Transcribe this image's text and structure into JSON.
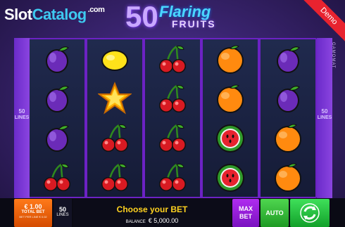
{
  "watermark": {
    "slot": "Slot",
    "catalog": "Catalog",
    "dotcom": ".com"
  },
  "logo": {
    "number": "50",
    "flaring": "Flaring",
    "fruits": "FRUITS"
  },
  "demo_label": "Demo",
  "provider": "GAMOMAT",
  "side_lines": {
    "count": "50",
    "label": "LINES"
  },
  "reels": [
    [
      "plum",
      "plum",
      "plum",
      "cherry"
    ],
    [
      "lemon",
      "star",
      "cherry",
      "cherry"
    ],
    [
      "cherry",
      "cherry",
      "cherry",
      "cherry"
    ],
    [
      "orange",
      "orange",
      "watermelon",
      "watermelon"
    ],
    [
      "plum",
      "plum",
      "orange",
      "orange"
    ]
  ],
  "bottom": {
    "bet_value": "€ 1.00",
    "bet_label": "TOTAL BET",
    "bet_sub": "BET PER LINE € 0.02",
    "lines_count": "50",
    "lines_label": "LINES",
    "message": "Choose your BET",
    "balance_label": "BALANCE",
    "balance_value": "€ 5,000.00",
    "maxbet_label": "MAX BET",
    "auto_label": "AUTO"
  }
}
